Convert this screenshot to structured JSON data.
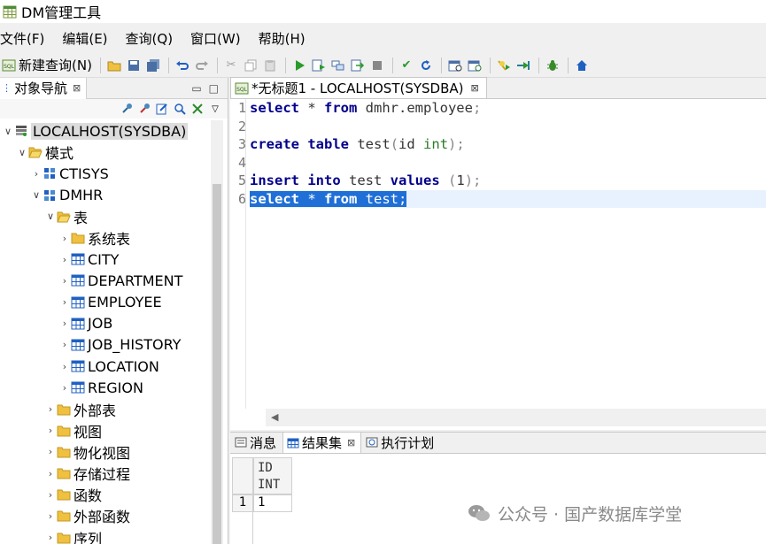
{
  "window": {
    "title": "DM管理工具"
  },
  "menu": [
    "文件(F)",
    "编辑(E)",
    "查询(Q)",
    "窗口(W)",
    "帮助(H)"
  ],
  "toolbar": {
    "new_query_label": "新建查询(N)",
    "icons": [
      "open-folder-icon",
      "save-icon",
      "save-all-icon",
      "undo-icon",
      "redo-icon",
      "cut-icon",
      "copy-icon",
      "paste-icon",
      "run-icon",
      "run-script-icon",
      "explain-icon",
      "export-icon",
      "stop-icon",
      "commit-icon",
      "rollback-icon",
      "calendar-icon",
      "schedule-icon",
      "debug-run-icon",
      "step-icon",
      "bug-icon",
      "home-icon"
    ]
  },
  "navigator": {
    "tab_label": "对象导航",
    "close_glyph": "⊠",
    "minimize_glyph": "▭",
    "maximize_glyph": "□",
    "tree": [
      {
        "label": "LOCALHOST(SYSDBA)",
        "level": 0,
        "twisty": "∨",
        "icon": "server-icon",
        "selected": true
      },
      {
        "label": "模式",
        "level": 1,
        "twisty": "∨",
        "icon": "folder-open-icon"
      },
      {
        "label": "CTISYS",
        "level": 2,
        "twisty": "›",
        "icon": "schema-icon"
      },
      {
        "label": "DMHR",
        "level": 2,
        "twisty": "∨",
        "icon": "schema-icon"
      },
      {
        "label": "表",
        "level": 3,
        "twisty": "∨",
        "icon": "folder-open-icon"
      },
      {
        "label": "系统表",
        "level": 4,
        "twisty": "›",
        "icon": "folder-icon"
      },
      {
        "label": "CITY",
        "level": 4,
        "twisty": "›",
        "icon": "table-icon"
      },
      {
        "label": "DEPARTMENT",
        "level": 4,
        "twisty": "›",
        "icon": "table-icon"
      },
      {
        "label": "EMPLOYEE",
        "level": 4,
        "twisty": "›",
        "icon": "table-icon"
      },
      {
        "label": "JOB",
        "level": 4,
        "twisty": "›",
        "icon": "table-icon"
      },
      {
        "label": "JOB_HISTORY",
        "level": 4,
        "twisty": "›",
        "icon": "table-icon"
      },
      {
        "label": "LOCATION",
        "level": 4,
        "twisty": "›",
        "icon": "table-icon"
      },
      {
        "label": "REGION",
        "level": 4,
        "twisty": "›",
        "icon": "table-icon"
      },
      {
        "label": "外部表",
        "level": 3,
        "twisty": "›",
        "icon": "folder-icon"
      },
      {
        "label": "视图",
        "level": 3,
        "twisty": "›",
        "icon": "folder-icon"
      },
      {
        "label": "物化视图",
        "level": 3,
        "twisty": "›",
        "icon": "folder-icon"
      },
      {
        "label": "存储过程",
        "level": 3,
        "twisty": "›",
        "icon": "folder-icon"
      },
      {
        "label": "函数",
        "level": 3,
        "twisty": "›",
        "icon": "folder-icon"
      },
      {
        "label": "外部函数",
        "level": 3,
        "twisty": "›",
        "icon": "folder-icon"
      },
      {
        "label": "序列",
        "level": 3,
        "twisty": "›",
        "icon": "folder-icon"
      }
    ]
  },
  "editor": {
    "tab_label": "*无标题1 - LOCALHOST(SYSDBA)",
    "lines": [
      {
        "n": "1",
        "tokens": [
          [
            "kw",
            "select"
          ],
          [
            "tx",
            " * "
          ],
          [
            "kw",
            "from"
          ],
          [
            "tx",
            " dmhr.employee"
          ],
          [
            "pu",
            ";"
          ]
        ]
      },
      {
        "n": "2",
        "tokens": []
      },
      {
        "n": "3",
        "tokens": [
          [
            "kw",
            "create"
          ],
          [
            "tx",
            " "
          ],
          [
            "kw",
            "table"
          ],
          [
            "tx",
            " test"
          ],
          [
            "pu",
            "("
          ],
          [
            "tx",
            "id "
          ],
          [
            "ty",
            "int"
          ],
          [
            "pu",
            ");"
          ]
        ]
      },
      {
        "n": "4",
        "tokens": []
      },
      {
        "n": "5",
        "tokens": [
          [
            "kw",
            "insert"
          ],
          [
            "tx",
            " "
          ],
          [
            "kw",
            "into"
          ],
          [
            "tx",
            " test "
          ],
          [
            "kw",
            "values"
          ],
          [
            "tx",
            " "
          ],
          [
            "pu",
            "("
          ],
          [
            "tx",
            "1"
          ],
          [
            "pu",
            ");"
          ]
        ]
      },
      {
        "n": "6",
        "tokens": [
          [
            "kw",
            "select"
          ],
          [
            "tx",
            " * "
          ],
          [
            "kw",
            "from"
          ],
          [
            "tx",
            " test;"
          ]
        ],
        "selected": true
      }
    ]
  },
  "results": {
    "tabs": [
      {
        "label": "消息",
        "icon": "message-icon",
        "active": false
      },
      {
        "label": "结果集",
        "icon": "grid-icon",
        "active": true,
        "close": "⊠"
      },
      {
        "label": "执行计划",
        "icon": "plan-icon",
        "active": false
      }
    ],
    "column": {
      "name": "ID",
      "type": "INT"
    },
    "rows": [
      {
        "num": "1",
        "value": "1"
      }
    ]
  },
  "watermark": {
    "text": "公众号 · 国产数据库学堂"
  }
}
